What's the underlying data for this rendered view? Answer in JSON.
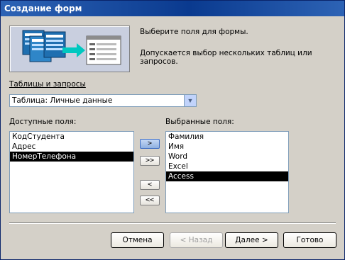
{
  "window": {
    "title": "Создание форм"
  },
  "description": {
    "line1": "Выберите поля для формы.",
    "line2": "Допускается выбор нескольких таблиц или запросов."
  },
  "tables": {
    "label": "Таблицы и запросы",
    "selected": "Таблица: Личные данные"
  },
  "available": {
    "label": "Доступные поля:",
    "items": [
      "КодСтудента",
      "Адрес",
      "НомерТелефона"
    ],
    "selected_index": 2
  },
  "selected_fields": {
    "label": "Выбранные поля:",
    "items": [
      "Фамилия",
      "Имя",
      "Word",
      "Excel",
      "Access"
    ],
    "selected_index": 4
  },
  "move_buttons": {
    "add_one": ">",
    "add_all": ">>",
    "remove_one": "<",
    "remove_all": "<<"
  },
  "footer": {
    "cancel": "Отмена",
    "back": "< Назад",
    "next": "Далее >",
    "finish": "Готово"
  },
  "colors": {
    "titlebar": "#0a3a8f",
    "dialog": "#d4d0c8",
    "selection": "#000000"
  },
  "icons": {
    "wizard_image": "tables-to-form-illustration",
    "dropdown": "chevron-down-icon"
  }
}
